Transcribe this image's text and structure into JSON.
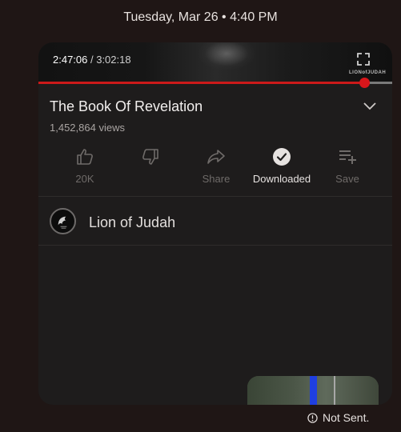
{
  "timestamp": "Tuesday, Mar 26 • 4:40 PM",
  "player": {
    "current_time": "2:47:06",
    "separator": " / ",
    "duration": "3:02:18",
    "progress_fraction": 0.921,
    "watermark": "LIONofJUDAH",
    "accent_color": "#cc1a1a"
  },
  "video": {
    "title": "The Book Of Revelation",
    "views": "1,452,864 views"
  },
  "actions": [
    {
      "id": "like",
      "label": "20K",
      "icon": "thumbs-up-icon",
      "active": false
    },
    {
      "id": "dislike",
      "label": "",
      "icon": "thumbs-down-icon",
      "active": false
    },
    {
      "id": "share",
      "label": "Share",
      "icon": "share-icon",
      "active": false
    },
    {
      "id": "downloaded",
      "label": "Downloaded",
      "icon": "check-circle-icon",
      "active": true
    },
    {
      "id": "save",
      "label": "Save",
      "icon": "playlist-add-icon",
      "active": false
    }
  ],
  "channel": {
    "name": "Lion of Judah"
  },
  "message_status": {
    "text": "Not Sent.",
    "icon": "alert-circle-icon"
  }
}
